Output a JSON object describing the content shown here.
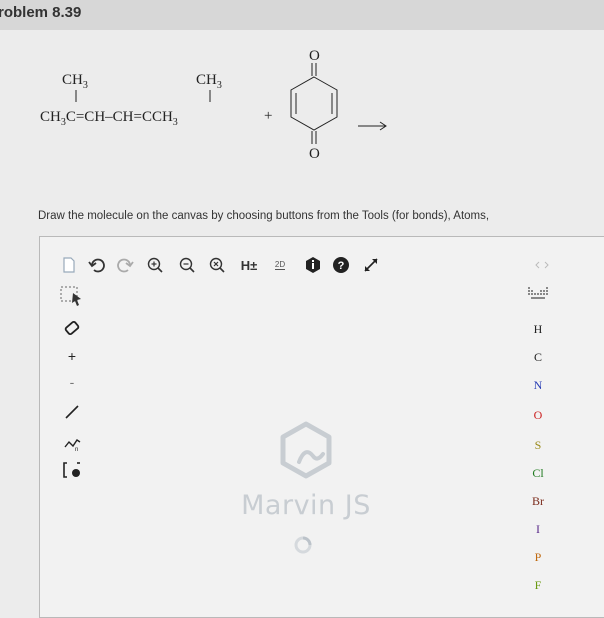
{
  "header": {
    "title": "roblem 8.39"
  },
  "reaction": {
    "left_ch3_top": "CH",
    "left_ch3_sub": "3",
    "right_ch3_top": "CH",
    "right_ch3_sub": "3",
    "chain_part1": "CH",
    "chain_sub1": "3",
    "chain_part2": "C=CH–CH=CCH",
    "chain_sub2": "3",
    "plus": "+",
    "ring_top_o": "O",
    "ring_bottom_o": "O",
    "arrow": "→"
  },
  "instruction": "Draw the molecule on the canvas by choosing buttons from the Tools (for bonds), Atoms,",
  "toolbar": {
    "hydrogen_toggle_label": "H±",
    "clean2d_label": "2D"
  },
  "atoms": [
    "H",
    "C",
    "N",
    "O",
    "S",
    "Cl",
    "Br",
    "I",
    "P",
    "F"
  ],
  "atom_colors": {
    "H": "#222222",
    "C": "#222222",
    "N": "#2a3fb5",
    "O": "#cc2222",
    "S": "#9a8a1a",
    "Cl": "#1f7a1f",
    "Br": "#7a2a1a",
    "I": "#5a2a8a",
    "P": "#c06a10",
    "F": "#6a9a10"
  },
  "left_tools": {
    "plus_label": "+",
    "minus_label": "-"
  },
  "canvas": {
    "logo_text": "Marvin JS"
  }
}
